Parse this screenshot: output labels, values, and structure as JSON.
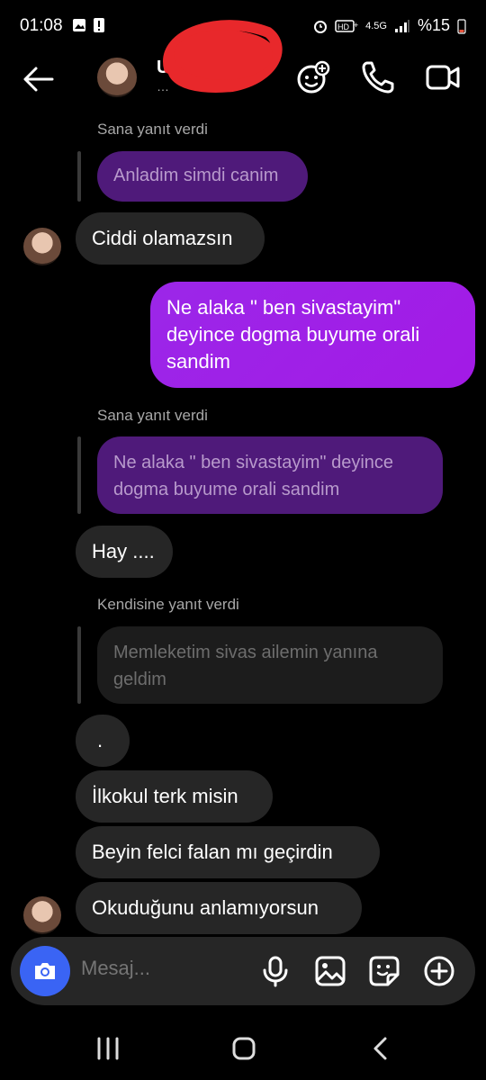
{
  "status_bar": {
    "time": "01:08",
    "network": "4.5G",
    "battery": "%15"
  },
  "header": {
    "name": "U",
    "subtitle": "…",
    "icons": [
      "back-arrow-icon",
      "avatar",
      "effects-icon",
      "phone-icon",
      "video-icon"
    ]
  },
  "messages": [
    {
      "type": "reply_label",
      "text": "Sana yanıt verdi"
    },
    {
      "type": "quote_out",
      "text": "Anladim simdi canim"
    },
    {
      "type": "in",
      "text": "Ciddi olamazsın"
    },
    {
      "type": "out",
      "text": "Ne alaka \" ben sivastayim\" deyince dogma buyume orali sandim"
    },
    {
      "type": "reply_label",
      "text": "Sana yanıt verdi"
    },
    {
      "type": "quote_out",
      "text": "Ne alaka \" ben sivastayim\" deyince dogma buyume orali sandim"
    },
    {
      "type": "in",
      "text": "Hay ...."
    },
    {
      "type": "reply_label",
      "text": "Kendisine yanıt verdi"
    },
    {
      "type": "quote_in",
      "text": "Memleketim sivas ailemin yanına geldim"
    },
    {
      "type": "in",
      "text": "."
    },
    {
      "type": "in",
      "text": "İlkokul terk misin"
    },
    {
      "type": "in",
      "text": "Beyin felci falan mı geçirdin"
    },
    {
      "type": "in",
      "text": "Okuduğunu anlamıyorsun"
    }
  ],
  "composer": {
    "placeholder": "Mesaj...",
    "icons": [
      "camera-icon",
      "microphone-icon",
      "gallery-icon",
      "sticker-icon",
      "add-icon"
    ]
  },
  "navigation": {
    "icons": [
      "recents-icon",
      "home-icon",
      "back-icon"
    ]
  },
  "colors": {
    "background": "#000000",
    "incoming_bubble": "#262626",
    "outgoing_bubble": "#a31ae6",
    "quoted_outgoing": "#4f1a7a",
    "camera_button": "#3a64f4"
  }
}
